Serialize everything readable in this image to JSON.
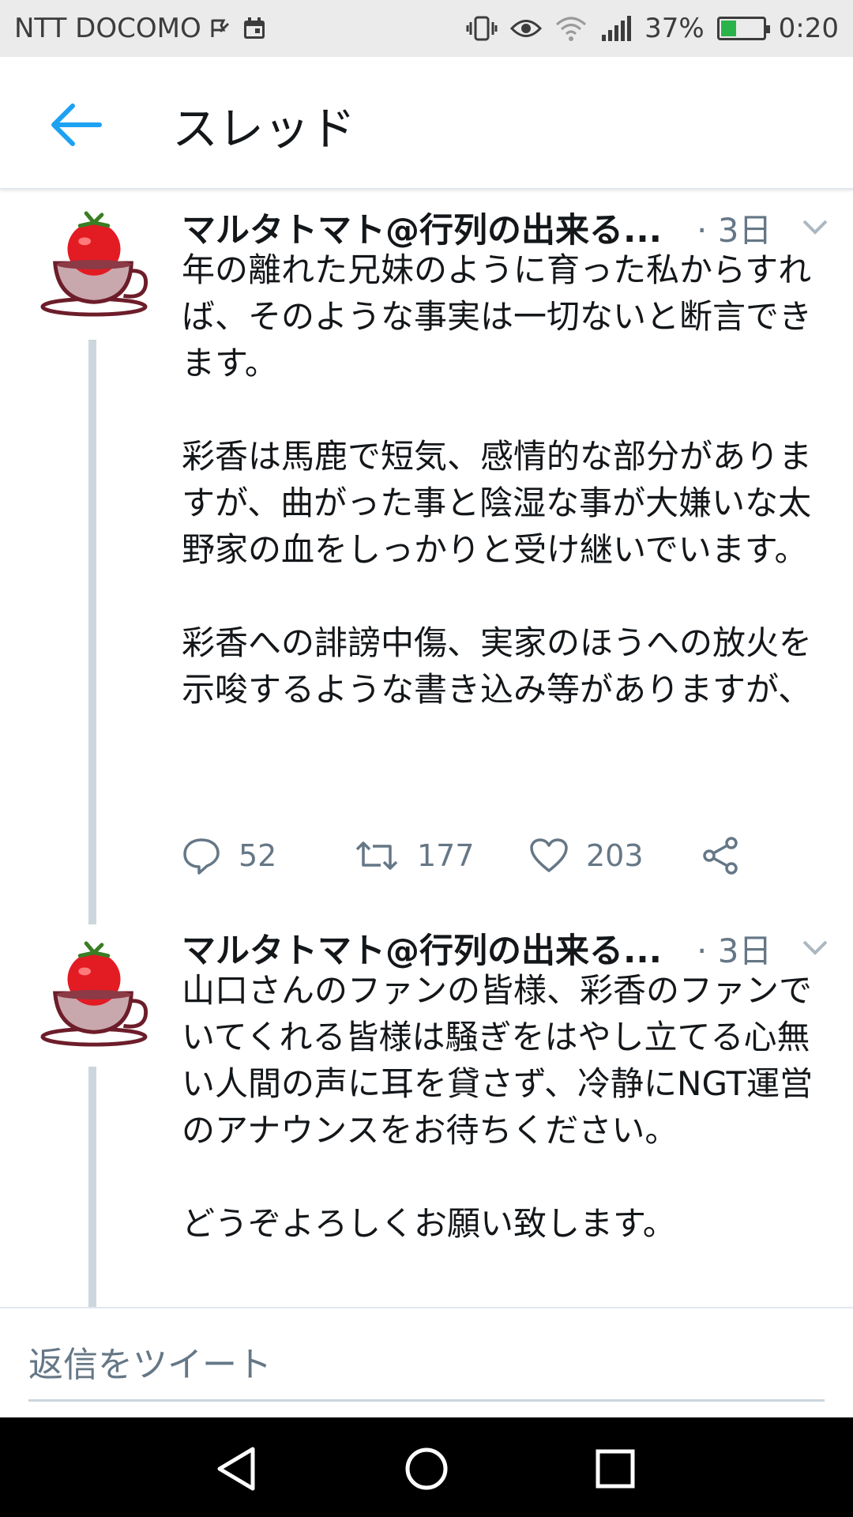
{
  "status_bar": {
    "carrier": "NTT DOCOMO",
    "battery": "37%",
    "battery_level": 0.37,
    "time": "0:20"
  },
  "header": {
    "title": "スレッド"
  },
  "tweets": [
    {
      "name": "マルタトマト@行列の出来る...",
      "time": "· 3日",
      "text": "年の離れた兄妹のように育った私からすれば、そのような事実は一切ないと断言できます。\n\n彩香は馬鹿で短気、感情的な部分がありますが、曲がった事と陰湿な事が大嫌いな太野家の血をしっかりと受け継いでいます。\n\n彩香への誹謗中傷、実家のほうへの放火を示唆するような書き込み等がありますが、",
      "replies": "52",
      "retweets": "177",
      "likes": "203"
    },
    {
      "name": "マルタトマト@行列の出来る...",
      "time": "· 3日",
      "text": "山口さんのファンの皆様、彩香のファンでいてくれる皆様は騒ぎをはやし立てる心無い人間の声に耳を貸さず、冷静にNGT運営のアナウンスをお待ちください。\n\nどうぞよろしくお願い致します。"
    }
  ],
  "reply_bar": {
    "placeholder": "返信をツイート"
  },
  "colors": {
    "accent": "#1da1f2",
    "secondary_text": "#657786",
    "thread_line": "#ccd6dd",
    "status_bar_bg": "#ebebeb",
    "nav_bar_bg": "#000000"
  }
}
